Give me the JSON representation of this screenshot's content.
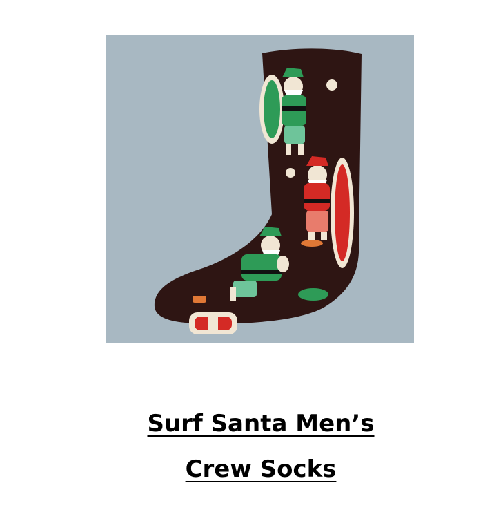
{
  "product": {
    "title": "Surf Santa Men’s Crew Socks",
    "image": {
      "alt": "Surf Santa Men’s Crew Socks",
      "background_color": "#a8b8c2",
      "sock_color": "#2e1513",
      "accent_colors": [
        "#2e9b57",
        "#d42a25",
        "#f1e6d4"
      ]
    }
  }
}
